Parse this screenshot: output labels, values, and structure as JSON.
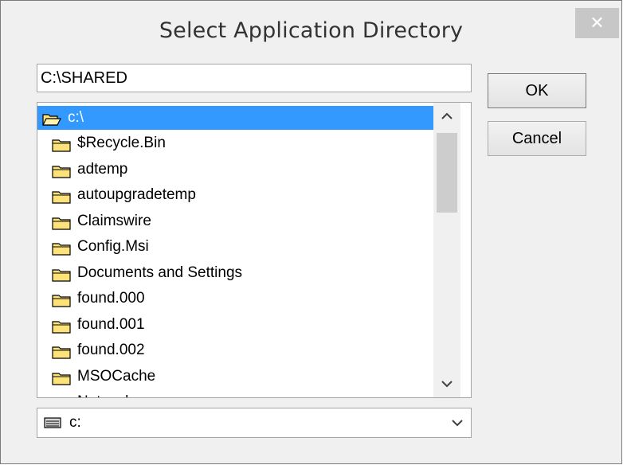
{
  "window": {
    "title": "Select Application Directory",
    "close_glyph": "✕"
  },
  "path_field": {
    "value": "C:\\SHARED"
  },
  "buttons": {
    "ok_label": "OK",
    "cancel_label": "Cancel"
  },
  "directory_list": {
    "root": {
      "label": "c:\\",
      "icon": "open-folder-icon",
      "selected": true
    },
    "items": [
      {
        "label": "$Recycle.Bin",
        "icon": "folder-icon"
      },
      {
        "label": "adtemp",
        "icon": "folder-icon"
      },
      {
        "label": "autoupgradetemp",
        "icon": "folder-icon"
      },
      {
        "label": "Claimswire",
        "icon": "folder-icon"
      },
      {
        "label": "Config.Msi",
        "icon": "folder-icon"
      },
      {
        "label": "Documents and Settings",
        "icon": "folder-icon"
      },
      {
        "label": "found.000",
        "icon": "folder-icon"
      },
      {
        "label": "found.001",
        "icon": "folder-icon"
      },
      {
        "label": "found.002",
        "icon": "folder-icon"
      },
      {
        "label": "MSOCache",
        "icon": "folder-icon"
      },
      {
        "label": "Network",
        "icon": "folder-icon"
      }
    ]
  },
  "drive_select": {
    "value": "c:",
    "icon": "drive-icon"
  },
  "colors": {
    "selection": "#3399ff",
    "folder_fill": "#fde27a",
    "folder_stroke": "#000000",
    "dialog_bg": "#f0f0f0"
  }
}
